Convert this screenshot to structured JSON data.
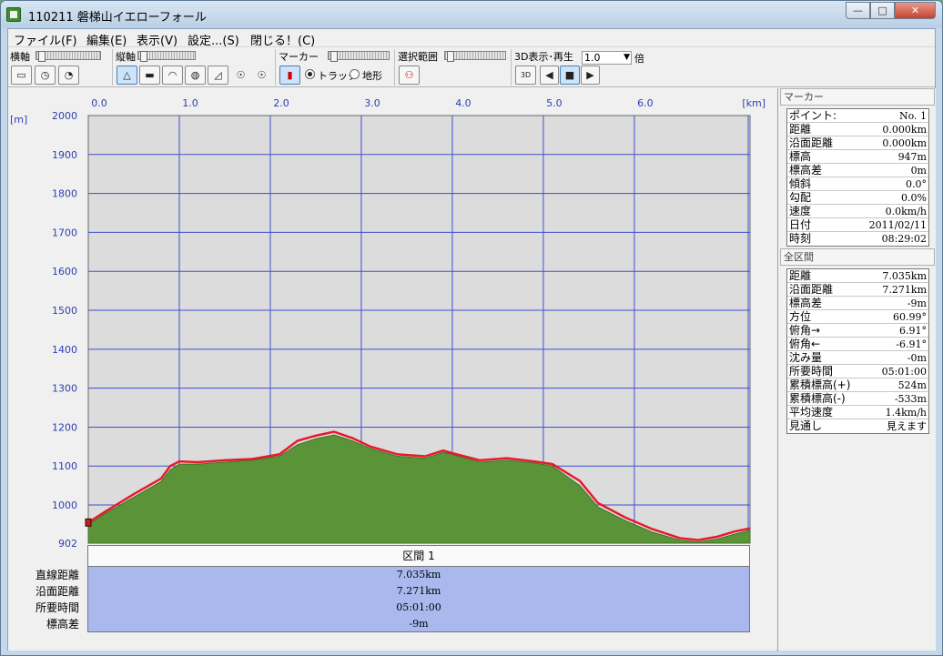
{
  "window": {
    "title": "110211 磐梯山イエローフォール",
    "min_glyph": "—",
    "max_glyph": "□",
    "close_glyph": "✕"
  },
  "menu": [
    "ファイル(F)",
    "編集(E)",
    "表示(V)",
    "設定...(S)",
    "閉じる！(C)"
  ],
  "toolbar": {
    "h_axis_label": "横軸",
    "v_axis_label": "縦軸",
    "marker_label": "マーカー",
    "track_label": "トラック",
    "terrain_label": "地形",
    "selection_label": "選択範囲",
    "play_label": "3D表示･再生",
    "speed_value": "1.0",
    "speed_unit": "倍",
    "btn_3d": "3D"
  },
  "chart_data": {
    "type": "area",
    "x_unit": "[km]",
    "y_unit": "[m]",
    "x_ticks": [
      "0.0",
      "1.0",
      "2.0",
      "3.0",
      "4.0",
      "5.0",
      "6.0"
    ],
    "y_ticks": [
      "2000",
      "1900",
      "1800",
      "1700",
      "1600",
      "1500",
      "1400",
      "1300",
      "1200",
      "1100",
      "1000",
      "902"
    ],
    "xlim": [
      0,
      7.271
    ],
    "ylim": [
      902,
      2000
    ],
    "grid": true,
    "series": [
      {
        "kind": "terrain",
        "color": "#5b9438",
        "x": [
          0,
          0.2,
          0.5,
          0.8,
          0.9,
          1.0,
          1.2,
          1.5,
          1.8,
          2.1,
          2.3,
          2.5,
          2.7,
          2.9,
          3.1,
          3.4,
          3.7,
          3.9,
          4.0,
          4.3,
          4.6,
          4.9,
          5.1,
          5.4,
          5.6,
          5.9,
          6.2,
          6.5,
          6.7,
          6.9,
          7.1,
          7.271
        ],
        "y": [
          950,
          980,
          1020,
          1060,
          1090,
          1105,
          1105,
          1110,
          1115,
          1125,
          1155,
          1170,
          1180,
          1165,
          1145,
          1125,
          1120,
          1135,
          1130,
          1110,
          1115,
          1108,
          1100,
          1050,
          995,
          960,
          930,
          910,
          905,
          912,
          925,
          935
        ]
      },
      {
        "kind": "track",
        "color": "#e8192a",
        "x": [
          0,
          0.2,
          0.5,
          0.8,
          0.9,
          1.0,
          1.2,
          1.5,
          1.8,
          2.1,
          2.3,
          2.5,
          2.7,
          2.9,
          3.1,
          3.4,
          3.7,
          3.9,
          4.0,
          4.3,
          4.6,
          4.9,
          5.1,
          5.4,
          5.6,
          5.9,
          6.2,
          6.5,
          6.7,
          6.9,
          7.1,
          7.271
        ],
        "y": [
          955,
          985,
          1028,
          1068,
          1100,
          1112,
          1110,
          1115,
          1118,
          1130,
          1165,
          1178,
          1188,
          1172,
          1150,
          1130,
          1125,
          1140,
          1133,
          1115,
          1120,
          1112,
          1105,
          1062,
          1005,
          968,
          938,
          915,
          910,
          918,
          932,
          940
        ]
      }
    ]
  },
  "segment": {
    "header": "区間 1",
    "labels": [
      "直線距離",
      "沿面距離",
      "所要時間",
      "標高差"
    ],
    "values": [
      "7.035km",
      "7.271km",
      "05:01:00",
      "-9m"
    ]
  },
  "marker_panel": {
    "title": "マーカー",
    "rows": [
      {
        "k": "ポイント:",
        "v": "No. 1"
      },
      {
        "k": "距離",
        "v": "0.000km"
      },
      {
        "k": "沿面距離",
        "v": "0.000km"
      },
      {
        "k": "標高",
        "v": "947m"
      },
      {
        "k": "標高差",
        "v": "0m"
      },
      {
        "k": "傾斜",
        "v": "0.0°"
      },
      {
        "k": "勾配",
        "v": "0.0%"
      },
      {
        "k": "速度",
        "v": "0.0km/h"
      },
      {
        "k": "日付",
        "v": "2011/02/11"
      },
      {
        "k": "時刻",
        "v": "08:29:02"
      }
    ]
  },
  "total_panel": {
    "title": "全区間",
    "rows": [
      {
        "k": "距離",
        "v": "7.035km"
      },
      {
        "k": "沿面距離",
        "v": "7.271km"
      },
      {
        "k": "標高差",
        "v": "-9m"
      },
      {
        "k": "方位",
        "v": "60.99°"
      },
      {
        "k": "俯角→",
        "v": "6.91°"
      },
      {
        "k": "俯角←",
        "v": "-6.91°"
      },
      {
        "k": "沈み量",
        "v": "-0m"
      },
      {
        "k": "所要時間",
        "v": "05:01:00"
      },
      {
        "k": "累積標高(+)",
        "v": "524m"
      },
      {
        "k": "累積標高(-)",
        "v": "-533m"
      },
      {
        "k": "平均速度",
        "v": "1.4km/h"
      },
      {
        "k": "見通し",
        "v": "見えます"
      }
    ]
  },
  "colors": {
    "plot_bg": "#dcdcdc",
    "grid": "#3e4fd0",
    "axis_text": "#2c3fb0",
    "segment_bg": "#a9b9ee"
  }
}
